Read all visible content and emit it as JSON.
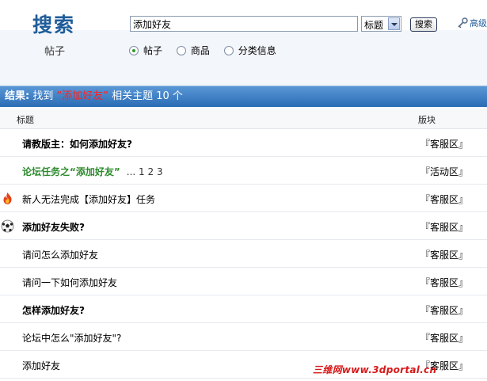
{
  "header": {
    "title": "搜索",
    "subtitle": "帖子",
    "search_value": "添加好友",
    "search_type": "标题",
    "search_button": "搜索",
    "advanced": "高级",
    "radios": [
      {
        "label": "帖子",
        "checked": true
      },
      {
        "label": "商品",
        "checked": false
      },
      {
        "label": "分类信息",
        "checked": false
      }
    ]
  },
  "result": {
    "label": "结果:",
    "prefix": "找到",
    "keyword": "“添加好友”",
    "suffix": "相关主题 10 个"
  },
  "columns": {
    "title": "标题",
    "forum": "版块"
  },
  "rows": [
    {
      "title": "请教版主：如何添加好友?",
      "pages": "",
      "forum": "『客服区』",
      "icon": "",
      "highlight": false,
      "bold": true
    },
    {
      "title": "论坛任务之“添加好友”",
      "pages": "... 1 2 3",
      "forum": "『活动区』",
      "icon": "",
      "highlight": true,
      "bold": true
    },
    {
      "title": "新人无法完成【添加好友】任务",
      "pages": "",
      "forum": "『客服区』",
      "icon": "fire-icon",
      "highlight": false,
      "bold": false
    },
    {
      "title": "添加好友失败?",
      "pages": "",
      "forum": "『客服区』",
      "icon": "soccer-ball-icon",
      "highlight": false,
      "bold": true
    },
    {
      "title": "请问怎么添加好友",
      "pages": "",
      "forum": "『客服区』",
      "icon": "",
      "highlight": false,
      "bold": false
    },
    {
      "title": "请问一下如何添加好友",
      "pages": "",
      "forum": "『客服区』",
      "icon": "",
      "highlight": false,
      "bold": false
    },
    {
      "title": "怎样添加好友?",
      "pages": "",
      "forum": "『客服区』",
      "icon": "",
      "highlight": false,
      "bold": true
    },
    {
      "title": "论坛中怎么\"添加好友\"?",
      "pages": "",
      "forum": "『客服区』",
      "icon": "",
      "highlight": false,
      "bold": false
    },
    {
      "title": "添加好友",
      "pages": "",
      "forum": "『客服区』",
      "icon": "",
      "highlight": false,
      "bold": false
    }
  ],
  "watermark": "三维网www.3dportal.cn"
}
